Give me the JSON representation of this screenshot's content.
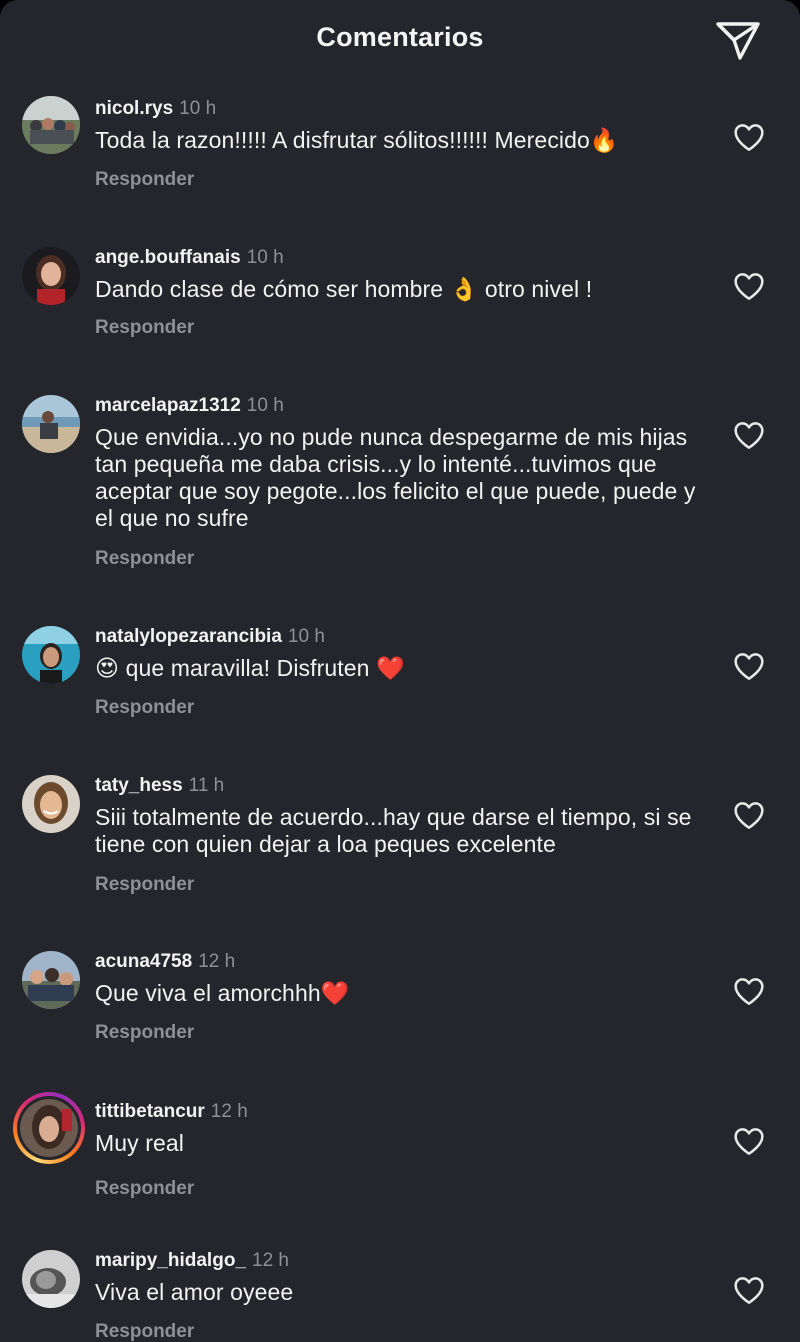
{
  "header": {
    "title": "Comentarios"
  },
  "reply_label": "Responder",
  "comments": [
    {
      "username": "nicol.rys",
      "time": "10 h",
      "text": "Toda la razon!!!!! A disfrutar sólitos!!!!!! Merecido🔥"
    },
    {
      "username": "ange.bouffanais",
      "time": "10 h",
      "text": "Dando clase de cómo ser hombre 👌 otro nivel !"
    },
    {
      "username": "marcelapaz1312",
      "time": "10 h",
      "text": "Que envidia...yo no pude nunca despegarme  de mis hijas tan pequeña me daba crisis...y lo intenté...tuvimos que aceptar que soy pegote...los felicito el que puede, puede y el que no sufre"
    },
    {
      "username": "natalylopezarancibia",
      "time": "10 h",
      "text": "😍 que maravilla! Disfruten ❤️"
    },
    {
      "username": "taty_hess",
      "time": "11 h",
      "text": "Siii totalmente de acuerdo...hay que darse el tiempo, si se tiene con quien dejar a loa peques excelente"
    },
    {
      "username": "acuna4758",
      "time": "12 h",
      "text": "Que viva el amorchhh❤️"
    },
    {
      "username": "tittibetancur",
      "time": "12 h",
      "text": "Muy real"
    },
    {
      "username": "maripy_hidalgo_",
      "time": "12 h",
      "text": "Viva el amor oyeee"
    }
  ],
  "colors": {
    "background": "#25262b",
    "text": "#f2f2f2",
    "muted": "#8e9096",
    "icon": "#e8e8e8"
  },
  "icons": {
    "share": "paper-plane-icon",
    "like": "heart-outline-icon"
  }
}
